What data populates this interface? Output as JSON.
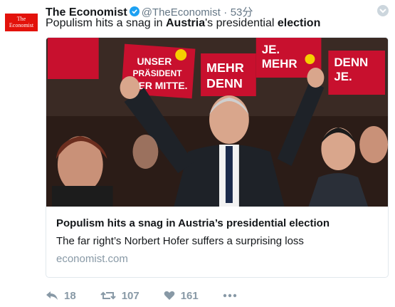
{
  "tweet": {
    "avatar": {
      "line1": "The",
      "line2": "Economist",
      "color": "#e3120b"
    },
    "author_name": "The Economist",
    "handle": "@TheEconomist",
    "separator": "·",
    "time": "53分",
    "verified": true,
    "text_parts": [
      "Populism hits a snag in ",
      "Austria",
      "'s presidential ",
      "election"
    ],
    "card": {
      "image_desc_signs": [
        "UNSER",
        "PRÄSIDENT",
        "DER MITTE.",
        "MEHR",
        "DENN",
        "JE.",
        "MEHR",
        "DENN",
        "JE."
      ],
      "title": "Populism hits a snag in Austria’s presidential election",
      "description": "The far right’s Norbert Hofer suffers a surprising loss",
      "domain": "economist.com"
    },
    "actions": {
      "replies": "18",
      "retweets": "107",
      "likes": "161"
    }
  },
  "colors": {
    "accent": "#1da1f2",
    "muted": "#8899a6",
    "sign_red": "#c8102e"
  }
}
